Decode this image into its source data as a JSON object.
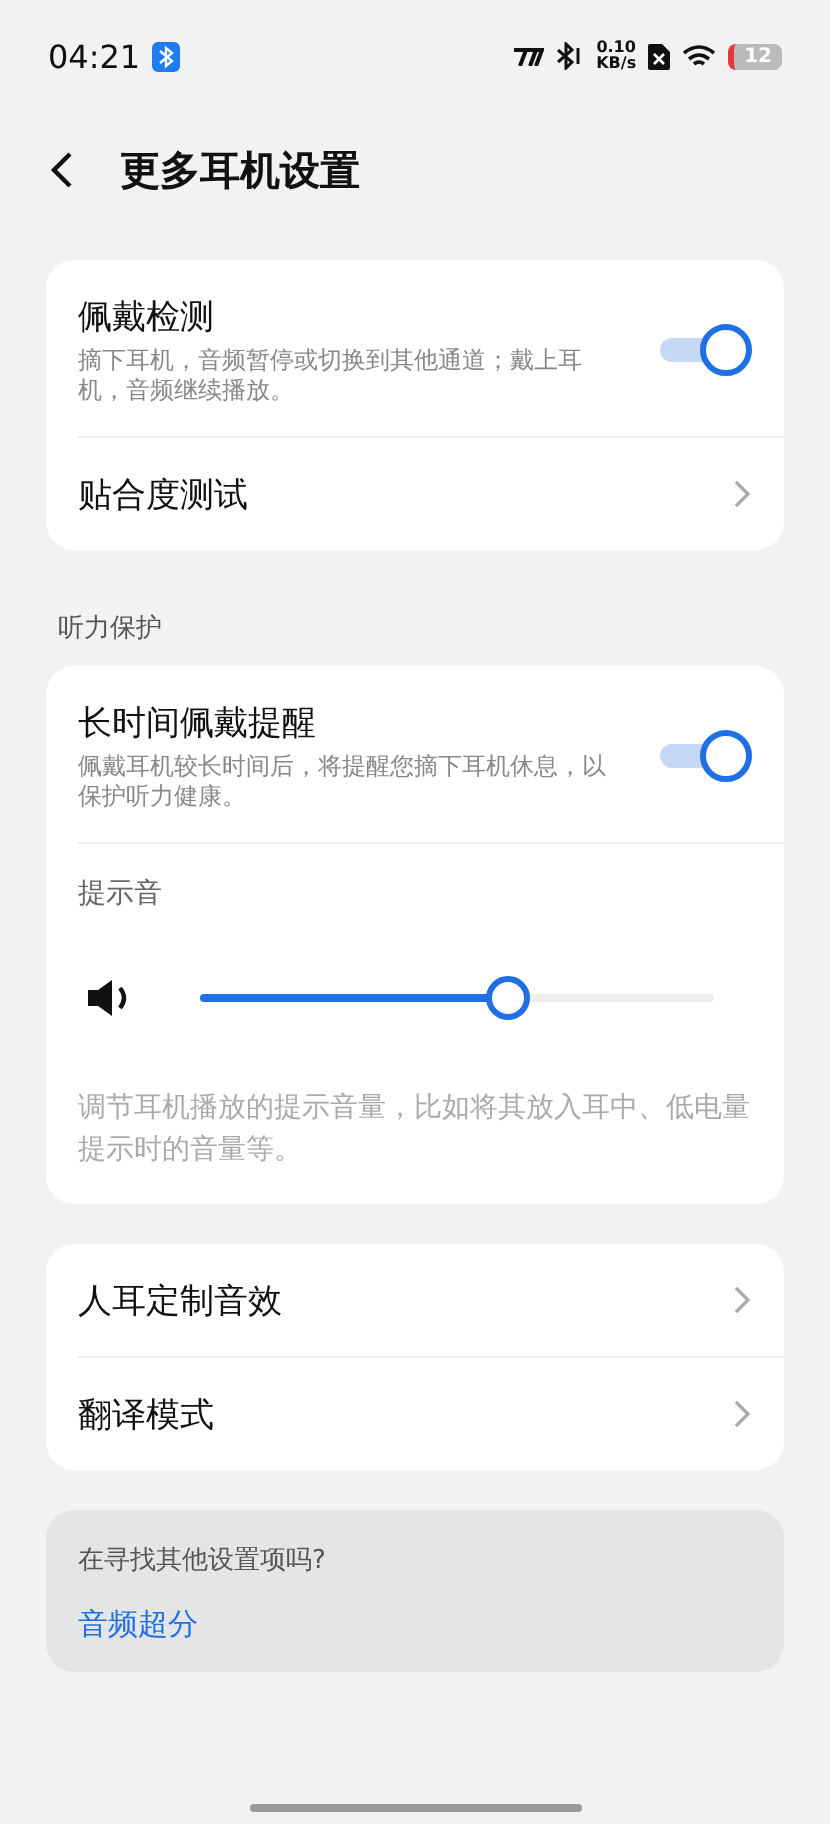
{
  "status_bar": {
    "time": "04:21",
    "net_speed": "0.10",
    "net_unit": "KB/s",
    "battery": "12"
  },
  "header": {
    "title": "更多耳机设置"
  },
  "sections": [
    {
      "rows": [
        {
          "kind": "toggle",
          "title": "佩戴检测",
          "description": "摘下耳机，音频暂停或切换到其他通道；戴上耳机，音频继续播放。",
          "on": true
        },
        {
          "kind": "nav",
          "title": "贴合度测试"
        }
      ]
    },
    {
      "heading": "听力保护",
      "rows": [
        {
          "kind": "toggle",
          "title": "长时间佩戴提醒",
          "description": "佩戴耳机较长时间后，将提醒您摘下耳机休息，以保护听力健康。",
          "on": true
        },
        {
          "kind": "slider",
          "label": "提示音",
          "level": 0.6,
          "caption": "调节耳机播放的提示音量，比如将其放入耳中、低电量提示时的音量等。"
        }
      ]
    },
    {
      "rows": [
        {
          "kind": "nav",
          "title": "人耳定制音效"
        },
        {
          "kind": "nav",
          "title": "翻译模式"
        }
      ]
    }
  ],
  "footer_card": {
    "question": "在寻找其他设置项吗?",
    "link": "音频超分"
  }
}
